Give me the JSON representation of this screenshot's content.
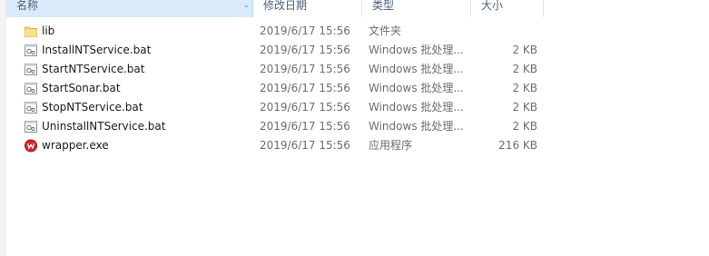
{
  "header": {
    "columns": [
      "名称",
      "修改日期",
      "类型",
      "大小"
    ]
  },
  "files": [
    {
      "name": "lib",
      "date": "2019/6/17 15:56",
      "type": "文件夹",
      "size": "",
      "icon": "folder-icon"
    },
    {
      "name": "InstallNTService.bat",
      "date": "2019/6/17 15:56",
      "type": "Windows 批处理...",
      "size": "2 KB",
      "icon": "batch-file-icon"
    },
    {
      "name": "StartNTService.bat",
      "date": "2019/6/17 15:56",
      "type": "Windows 批处理...",
      "size": "2 KB",
      "icon": "batch-file-icon"
    },
    {
      "name": "StartSonar.bat",
      "date": "2019/6/17 15:56",
      "type": "Windows 批处理...",
      "size": "2 KB",
      "icon": "batch-file-icon"
    },
    {
      "name": "StopNTService.bat",
      "date": "2019/6/17 15:56",
      "type": "Windows 批处理...",
      "size": "2 KB",
      "icon": "batch-file-icon"
    },
    {
      "name": "UninstallNTService.bat",
      "date": "2019/6/17 15:56",
      "type": "Windows 批处理...",
      "size": "2 KB",
      "icon": "batch-file-icon"
    },
    {
      "name": "wrapper.exe",
      "date": "2019/6/17 15:56",
      "type": "应用程序",
      "size": "216 KB",
      "icon": "wrapper-app-icon"
    }
  ],
  "colors": {
    "header_text": "#4c607a",
    "sorted_header_bg": "#d9ebf9",
    "folder": "#f8d775",
    "app_icon": "#d8232a"
  }
}
